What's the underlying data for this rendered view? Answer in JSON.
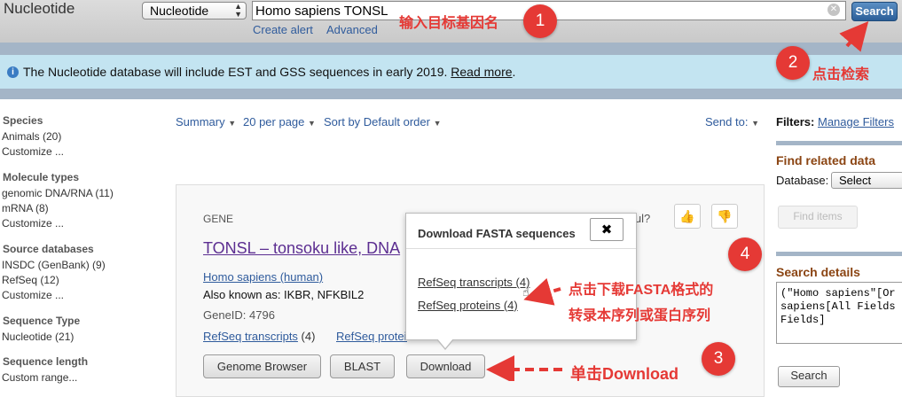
{
  "header": {
    "brand": "Nucleotide",
    "db_select": "Nucleotide",
    "search_value": "Homo sapiens TONSL",
    "search_button": "Search",
    "create_alert": "Create alert",
    "advanced": "Advanced"
  },
  "banner": {
    "text": "The Nucleotide database will include EST and GSS sequences in early 2019. ",
    "link": "Read more",
    "period": "."
  },
  "sidebar": {
    "species": {
      "title": "Species",
      "items": [
        "Animals (20)",
        "Customize ..."
      ]
    },
    "molecule": {
      "title": "Molecule types",
      "items": [
        "genomic DNA/RNA (11)",
        "mRNA (8)",
        "Customize ..."
      ]
    },
    "source": {
      "title": "Source databases",
      "items": [
        "INSDC (GenBank) (9)",
        "RefSeq (12)",
        "Customize ..."
      ]
    },
    "seqtype": {
      "title": "Sequence Type",
      "items": [
        "Nucleotide (21)"
      ]
    },
    "seqlen": {
      "title": "Sequence length",
      "items": [
        "Custom range..."
      ]
    }
  },
  "toolbar": {
    "summary": "Summary",
    "per_page": "20 per page",
    "sort": "Sort by Default order",
    "send_to": "Send to:"
  },
  "right": {
    "filters_label": "Filters:",
    "manage_filters": "Manage Filters",
    "find_related": "Find related data",
    "database_label": "Database:",
    "database_select": "Select",
    "find_items": "Find items",
    "search_details": "Search details",
    "details_text": "(\"Homo sapiens\"[Or\nsapiens[All Fields\nFields]",
    "search_button": "Search"
  },
  "result": {
    "label": "GENE",
    "title": "TONSL – tonsoku like, DNA",
    "helpful": "oful?",
    "organism": "Homo sapiens (human)",
    "aka": "Also known as: IKBR, NFKBIL2",
    "gene_id": "GeneID: 4796",
    "rt_link": "RefSeq transcripts",
    "rt_count": " (4)",
    "rp_link": "RefSeq proteins (4)",
    "buttons": {
      "genome_browser": "Genome Browser",
      "blast": "BLAST",
      "download": "Download"
    }
  },
  "popup": {
    "title": "Download FASTA sequences",
    "close": "✖",
    "transcripts": "RefSeq transcripts (4)",
    "proteins": "RefSeq proteins (4)"
  },
  "annotations": {
    "step1": "1",
    "step1_text": "输入目标基因名",
    "step2": "2",
    "step2_text": "点击检索",
    "step3": "3",
    "step3_text": "单击Download",
    "step4": "4",
    "step4_line1": "点击下载FASTA格式的",
    "step4_line2": "转录本序列或蛋白序列"
  },
  "colors": {
    "annotation_red": "#e53935",
    "link_blue": "#2f5b9c",
    "title_purple": "#5c2e91",
    "section_brown": "#8b4513"
  }
}
